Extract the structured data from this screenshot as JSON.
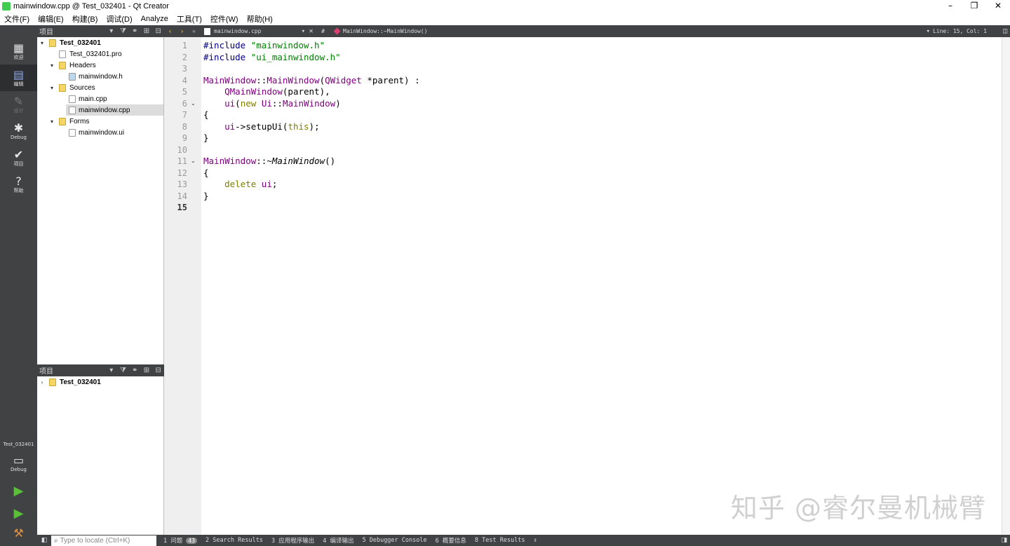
{
  "window": {
    "title": "mainwindow.cpp @ Test_032401 - Qt Creator",
    "buttons": [
      "–",
      "❐",
      "✕"
    ]
  },
  "menu": [
    "文件(F)",
    "编辑(E)",
    "构建(B)",
    "调试(D)",
    "Analyze",
    "工具(T)",
    "控件(W)",
    "帮助(H)"
  ],
  "modes": [
    {
      "label": "欢迎",
      "icon": "grid-icon"
    },
    {
      "label": "编辑",
      "icon": "edit-doc-icon"
    },
    {
      "label": "设计",
      "icon": "pencil-icon"
    },
    {
      "label": "Debug",
      "icon": "bug-icon"
    },
    {
      "label": "项目",
      "icon": "wrench-icon"
    },
    {
      "label": "帮助",
      "icon": "help-icon"
    }
  ],
  "kit": {
    "project": "Test_032401",
    "label": "Debug"
  },
  "project_panel": {
    "title": "项目",
    "items": [
      {
        "label": "Test_032401"
      },
      {
        "label": "Test_032401.pro"
      },
      {
        "label": "Headers"
      },
      {
        "label": "mainwindow.h"
      },
      {
        "label": "Sources"
      },
      {
        "label": "main.cpp"
      },
      {
        "label": "mainwindow.cpp"
      },
      {
        "label": "Forms"
      },
      {
        "label": "mainwindow.ui"
      }
    ]
  },
  "open_docs_panel": {
    "title": "项目",
    "items": [
      {
        "label": "Test_032401"
      }
    ]
  },
  "editor": {
    "file": "mainwindow.cpp",
    "symbol": "MainWindow::~MainWindow()",
    "hash": "#",
    "position": "Line: 15, Col: 1",
    "line_numbers": [
      "1",
      "2",
      "3",
      "4",
      "5",
      "6",
      "7",
      "8",
      "9",
      "10",
      "11",
      "12",
      "13",
      "14",
      "15"
    ],
    "current_line": "15",
    "code": [
      "#include \"mainwindow.h\"",
      "#include \"ui_mainwindow.h\"",
      "",
      "MainWindow::MainWindow(QWidget *parent) :",
      "    QMainWindow(parent),",
      "    ui(new Ui::MainWindow)",
      "{",
      "    ui->setupUi(this);",
      "}",
      "",
      "MainWindow::~MainWindow()",
      "{",
      "    delete ui;",
      "}",
      ""
    ]
  },
  "watermark": "知乎 @睿尔曼机械臂",
  "statusbar": {
    "locator_placeholder": "Type to locate (Ctrl+K)",
    "tabs": [
      {
        "num": "1",
        "label": "问题",
        "badge": "43"
      },
      {
        "num": "2",
        "label": "Search Results"
      },
      {
        "num": "3",
        "label": "应用程序输出"
      },
      {
        "num": "4",
        "label": "编译输出"
      },
      {
        "num": "5",
        "label": "Debugger Console"
      },
      {
        "num": "6",
        "label": "概要信息"
      },
      {
        "num": "8",
        "label": "Test Results"
      }
    ]
  }
}
